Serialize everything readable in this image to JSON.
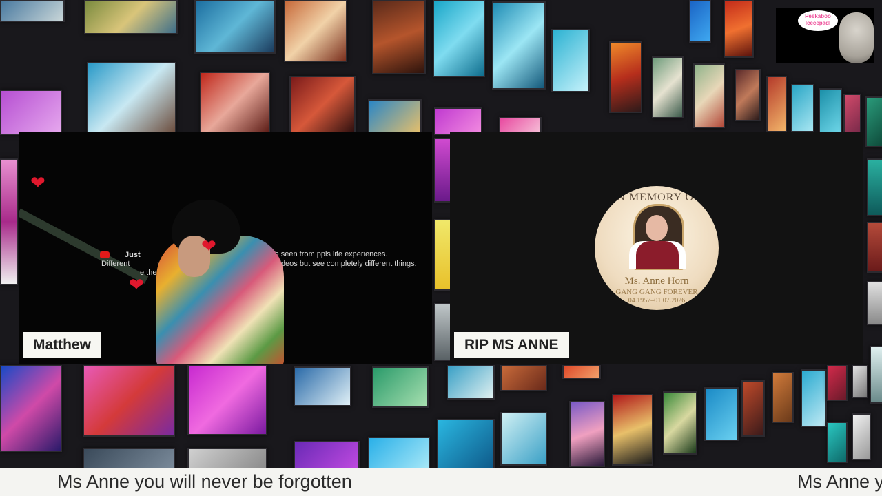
{
  "panels": {
    "left": {
      "name_tag": "Matthew",
      "caption_line1_left": "Just",
      "caption_line1_right": "ngs are seen from ppls life experiences.",
      "caption_line2_left": "Different",
      "caption_line2_mid": "ve",
      "caption_line2_right": "videos but see completely different things.",
      "caption_line3": "e the"
    },
    "right": {
      "name_tag": "RIP MS ANNE",
      "memorial": {
        "header": "IN MEMORY OF",
        "name": "Ms. Anne Horn",
        "subtitle": "GANG GANG FOREVER",
        "dates": "04.1957–01.07.2026"
      }
    }
  },
  "overlay": {
    "bubble_text": "Peekaboo Icecepadl"
  },
  "ticker": {
    "text": "Ms Anne you will never be forgotten",
    "text_repeat": "Ms Anne y"
  },
  "colors": {
    "heart": "#e0182d",
    "tag_bg": "#f7f7f2",
    "ticker_bg": "#f4f4f1"
  },
  "icons": [
    "heart-icon",
    "youtube-icon"
  ]
}
